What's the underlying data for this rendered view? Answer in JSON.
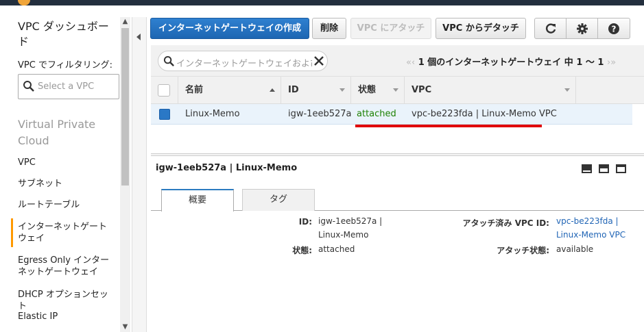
{
  "sidebar": {
    "title": "VPC ダッシュボード",
    "filter_label": "VPC でフィルタリング:",
    "select_placeholder": "Select a VPC",
    "section_title": "Virtual Private Cloud",
    "items": [
      {
        "label": "VPC"
      },
      {
        "label": "サブネット"
      },
      {
        "label": "ルートテーブル"
      },
      {
        "label": "インターネットゲートウェイ"
      },
      {
        "label": "Egress Only インターネットゲートウェイ"
      },
      {
        "label": "DHCP オプションセット"
      },
      {
        "label": "Elastic IP"
      }
    ],
    "active_index": 3
  },
  "toolbar": {
    "create_label": "インターネットゲートウェイの作成",
    "delete_label": "削除",
    "attach_label": "VPC にアタッチ",
    "detach_label": "VPC からデタッチ",
    "icons": [
      "refresh-icon",
      "gear-icon",
      "help-icon"
    ]
  },
  "search": {
    "placeholder": "インターネットゲートウェイおよび"
  },
  "pager": {
    "text": "1 個のインターネットゲートウェイ 中 1 〜 1"
  },
  "table": {
    "columns": [
      "名前",
      "ID",
      "状態",
      "VPC"
    ],
    "rows": [
      {
        "name": "Linux-Memo",
        "id": "igw-1eeb527a",
        "state": "attached",
        "vpc": "vpc-be223fda | Linux-Memo VPC"
      }
    ]
  },
  "detail": {
    "title": "igw-1eeb527a | Linux-Memo",
    "tabs": [
      "概要",
      "タグ"
    ],
    "fields": {
      "id_label": "ID:",
      "id_value_line1": "igw-1eeb527a |",
      "id_value_line2": "Linux-Memo",
      "state_label": "状態:",
      "state_value": "attached",
      "vpc_id_label": "アタッチ済み VPC ID:",
      "vpc_id_line1": "vpc-be223fda |",
      "vpc_id_line2": "Linux-Memo VPC",
      "attach_state_label": "アタッチ状態:",
      "attach_state_value": "available"
    }
  },
  "colors": {
    "primary": "#1d66b3",
    "green": "#1d8102",
    "annotation": "#e00000",
    "active": "#ff9900"
  }
}
